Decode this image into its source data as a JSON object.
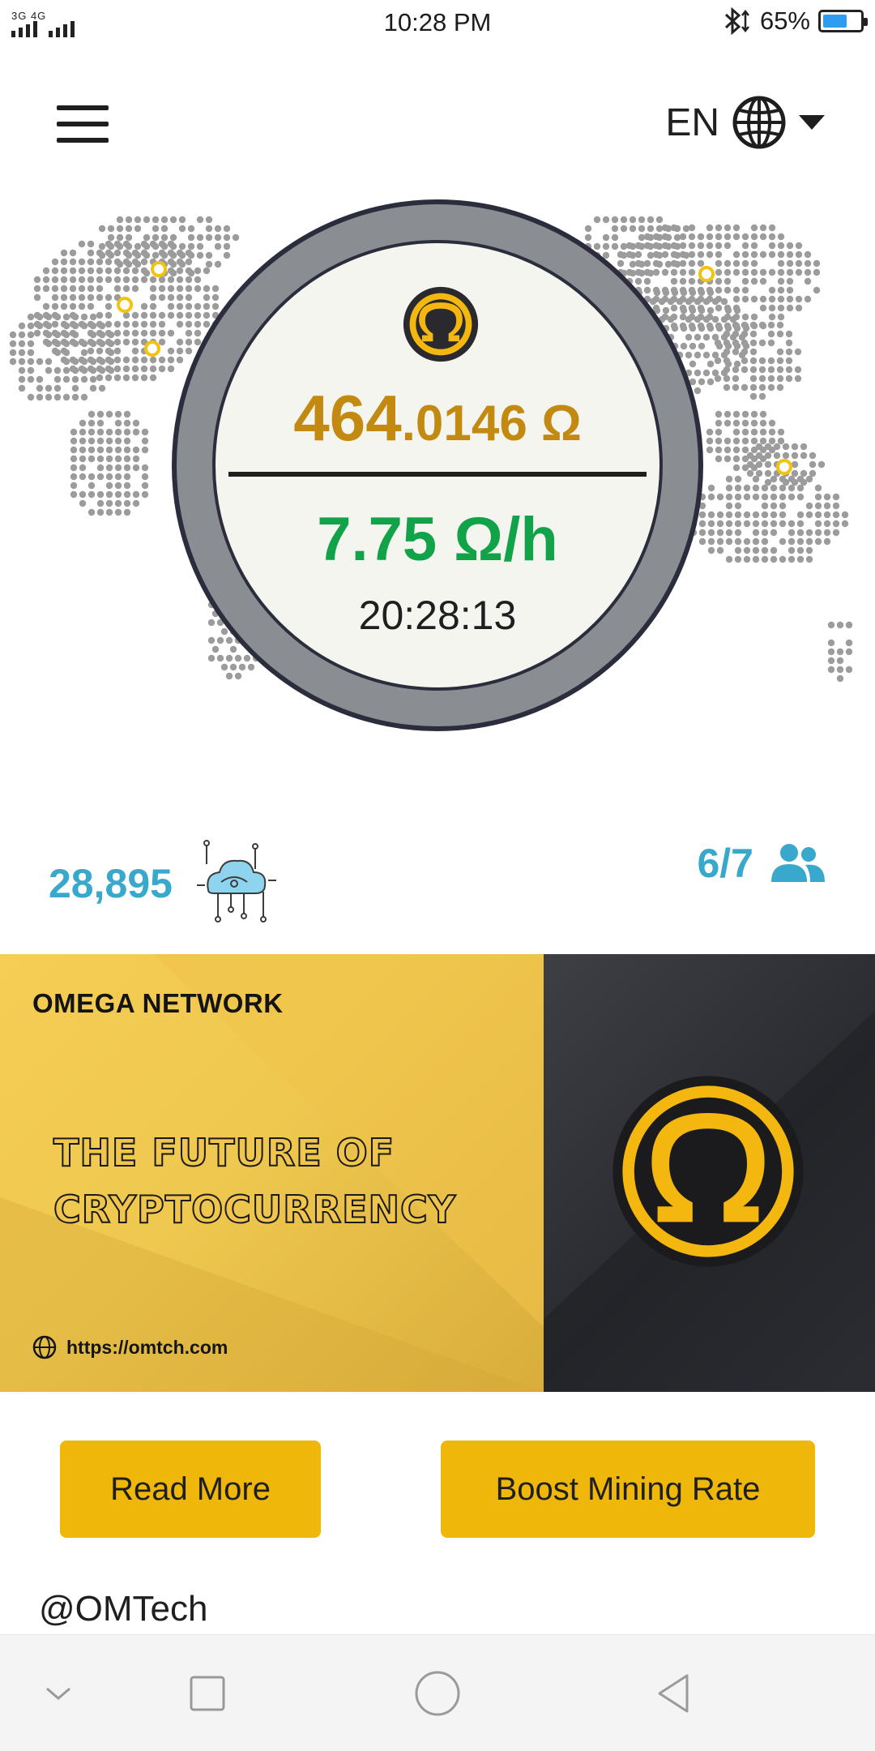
{
  "status_bar": {
    "network": "3G 4G",
    "time": "10:28 PM",
    "battery_percent": "65%",
    "battery_level": 0.65,
    "icons": [
      "bluetooth-icon",
      "battery-icon"
    ]
  },
  "header": {
    "menu_icon": "hamburger-menu-icon",
    "language_code": "EN",
    "language_icon": "globe-icon"
  },
  "mining": {
    "balance_integer": "464",
    "balance_decimal": ".0146 Ω",
    "rate": "7.75 Ω/h",
    "countdown": "20:28:13",
    "coin_icon": "omega-coin-icon"
  },
  "stats": {
    "network_count": "28,895",
    "network_icon": "cloud-network-icon",
    "team": "6/7",
    "team_icon": "users-icon"
  },
  "banner": {
    "brand": "OMEGA NETWORK",
    "tagline_line1": "THE FUTURE OF",
    "tagline_line2": "CRYPTOCURRENCY",
    "url": "https://omtch.com"
  },
  "actions": {
    "read_more": "Read More",
    "boost": "Boost Mining Rate"
  },
  "footer": {
    "handle": "@OMTech"
  },
  "nav_bar": [
    "back-chevron-icon",
    "recents-square-icon",
    "home-circle-icon",
    "back-triangle-icon"
  ],
  "colors": {
    "accent_gold": "#f0b70b",
    "balance": "#c28a10",
    "rate": "#12a34a",
    "stats": "#38a8cc"
  }
}
